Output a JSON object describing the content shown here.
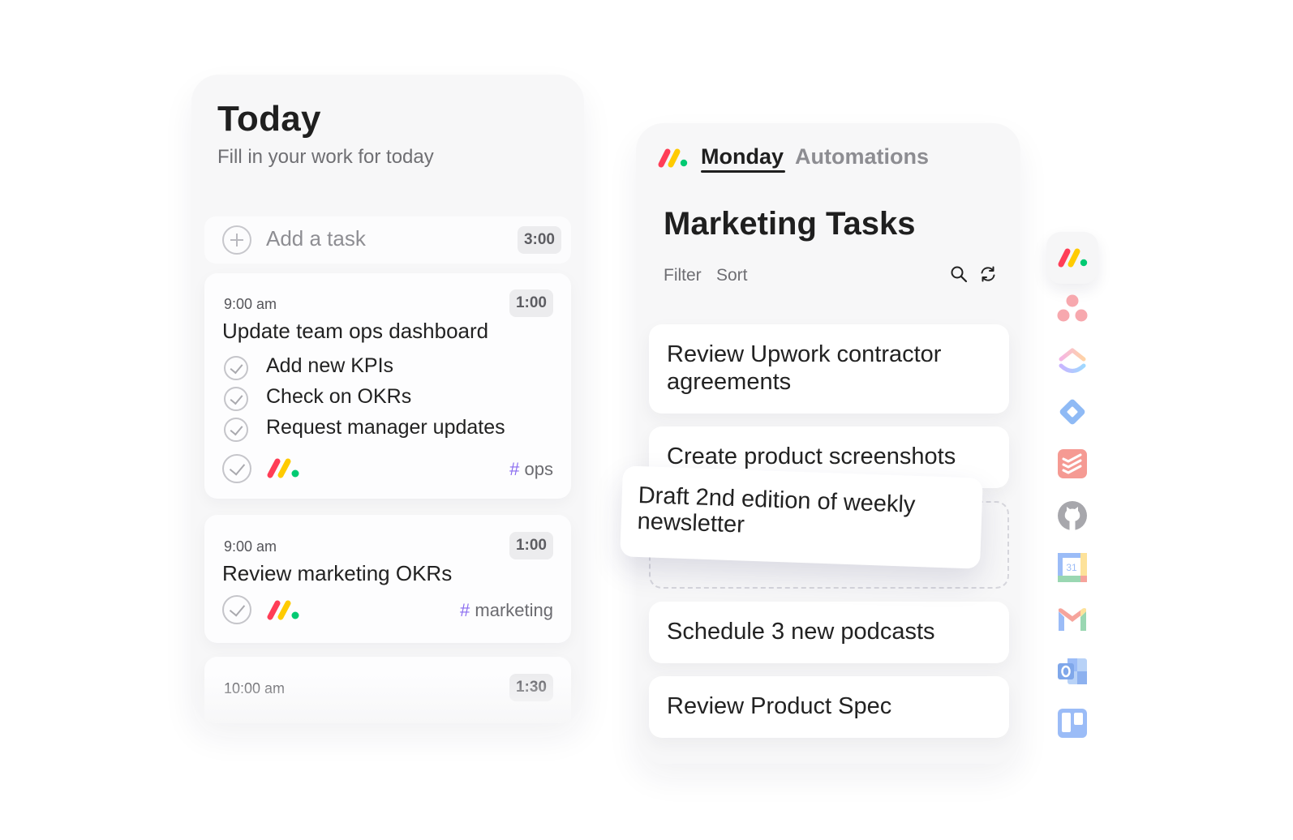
{
  "today": {
    "title": "Today",
    "subtitle": "Fill in your work for today",
    "add_task": {
      "placeholder": "Add a task",
      "duration": "3:00"
    },
    "cards": [
      {
        "time": "9:00 am",
        "duration": "1:00",
        "title": "Update team ops dashboard",
        "subtasks": [
          "Add new KPIs",
          "Check on OKRs",
          "Request manager updates"
        ],
        "tag": "ops",
        "source_icon": "monday-logo-icon"
      },
      {
        "time": "9:00 am",
        "duration": "1:00",
        "title": "Review marketing OKRs",
        "tag": "marketing",
        "source_icon": "monday-logo-icon"
      },
      {
        "time": "10:00 am",
        "duration": "1:30"
      }
    ],
    "tag_hash": "#"
  },
  "monday": {
    "tabs": [
      {
        "label": "Monday",
        "active": true
      },
      {
        "label": "Automations",
        "active": false
      }
    ],
    "board_title": "Marketing Tasks",
    "toolbar": {
      "filter": "Filter",
      "sort": "Sort",
      "icons": [
        "search-icon",
        "refresh-icon"
      ]
    },
    "tasks": [
      "Review Upwork contractor agreements",
      "Create product screenshots",
      "Schedule 3 new podcasts",
      "Review Product Spec"
    ],
    "dragging_task": "Draft 2nd edition of weekly newsletter"
  },
  "integrations": {
    "active": "monday",
    "items": [
      "monday-icon",
      "asana-icon",
      "clickup-icon",
      "jira-icon",
      "todoist-icon",
      "github-icon",
      "google-calendar-icon",
      "gmail-icon",
      "outlook-icon",
      "trello-icon"
    ],
    "calendar_day": "31"
  },
  "colors": {
    "monday_red": "#ff3d57",
    "monday_yellow": "#ffcb00",
    "monday_green": "#00ca72",
    "tag_hash": "#8a6cf0"
  }
}
